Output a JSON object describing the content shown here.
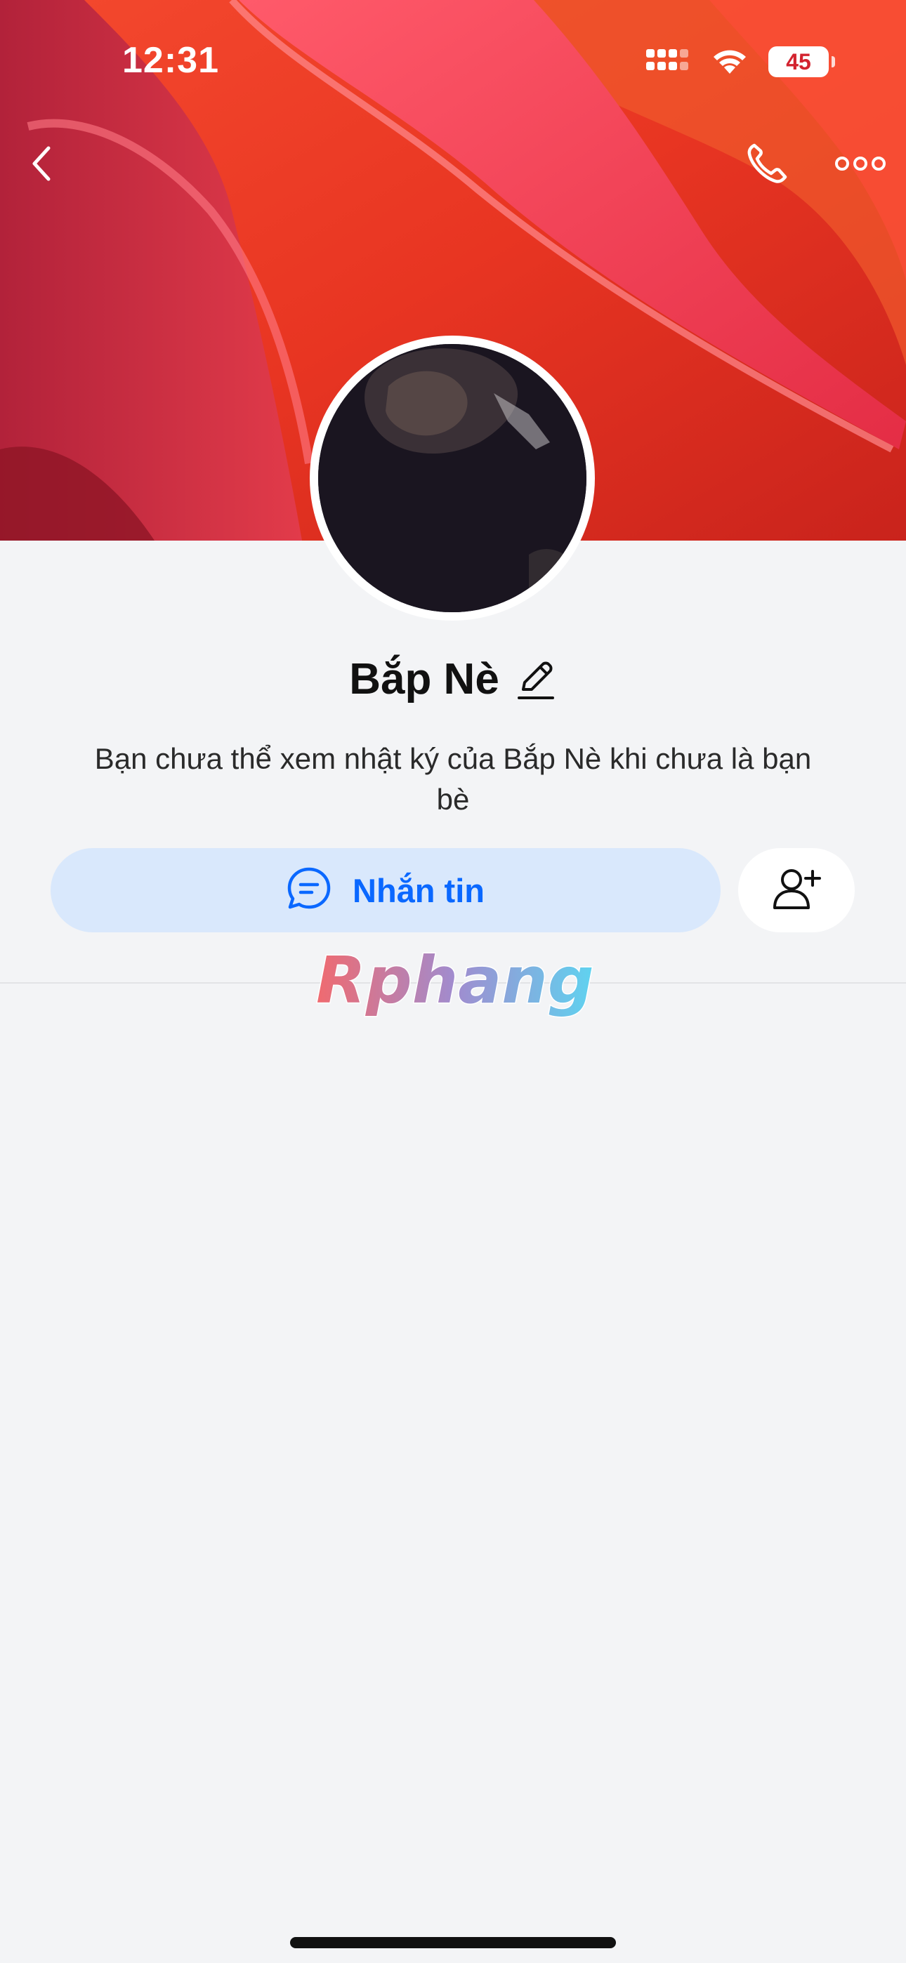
{
  "status_bar": {
    "time": "12:31",
    "battery_level": "45",
    "cellular_icon": "signal-bars-icon",
    "wifi_icon": "wifi-icon"
  },
  "nav": {
    "back_icon": "chevron-left-icon",
    "call_icon": "phone-icon",
    "more_icon": "more-horizontal-icon"
  },
  "profile": {
    "name": "Bắp Nè",
    "edit_icon": "pencil-icon",
    "info_text": "Bạn chưa thể xem nhật ký của Bắp Nè khi chưa là bạn bè"
  },
  "actions": {
    "message_label": "Nhắn tin",
    "message_icon": "chat-bubble-icon",
    "add_friend_icon": "add-user-icon"
  },
  "watermark": {
    "text": "Rphang"
  },
  "colors": {
    "accent": "#0a68ff",
    "message_button_bg": "#d9e8fc",
    "background": "#f3f4f6",
    "battery_text": "#d3232f"
  }
}
